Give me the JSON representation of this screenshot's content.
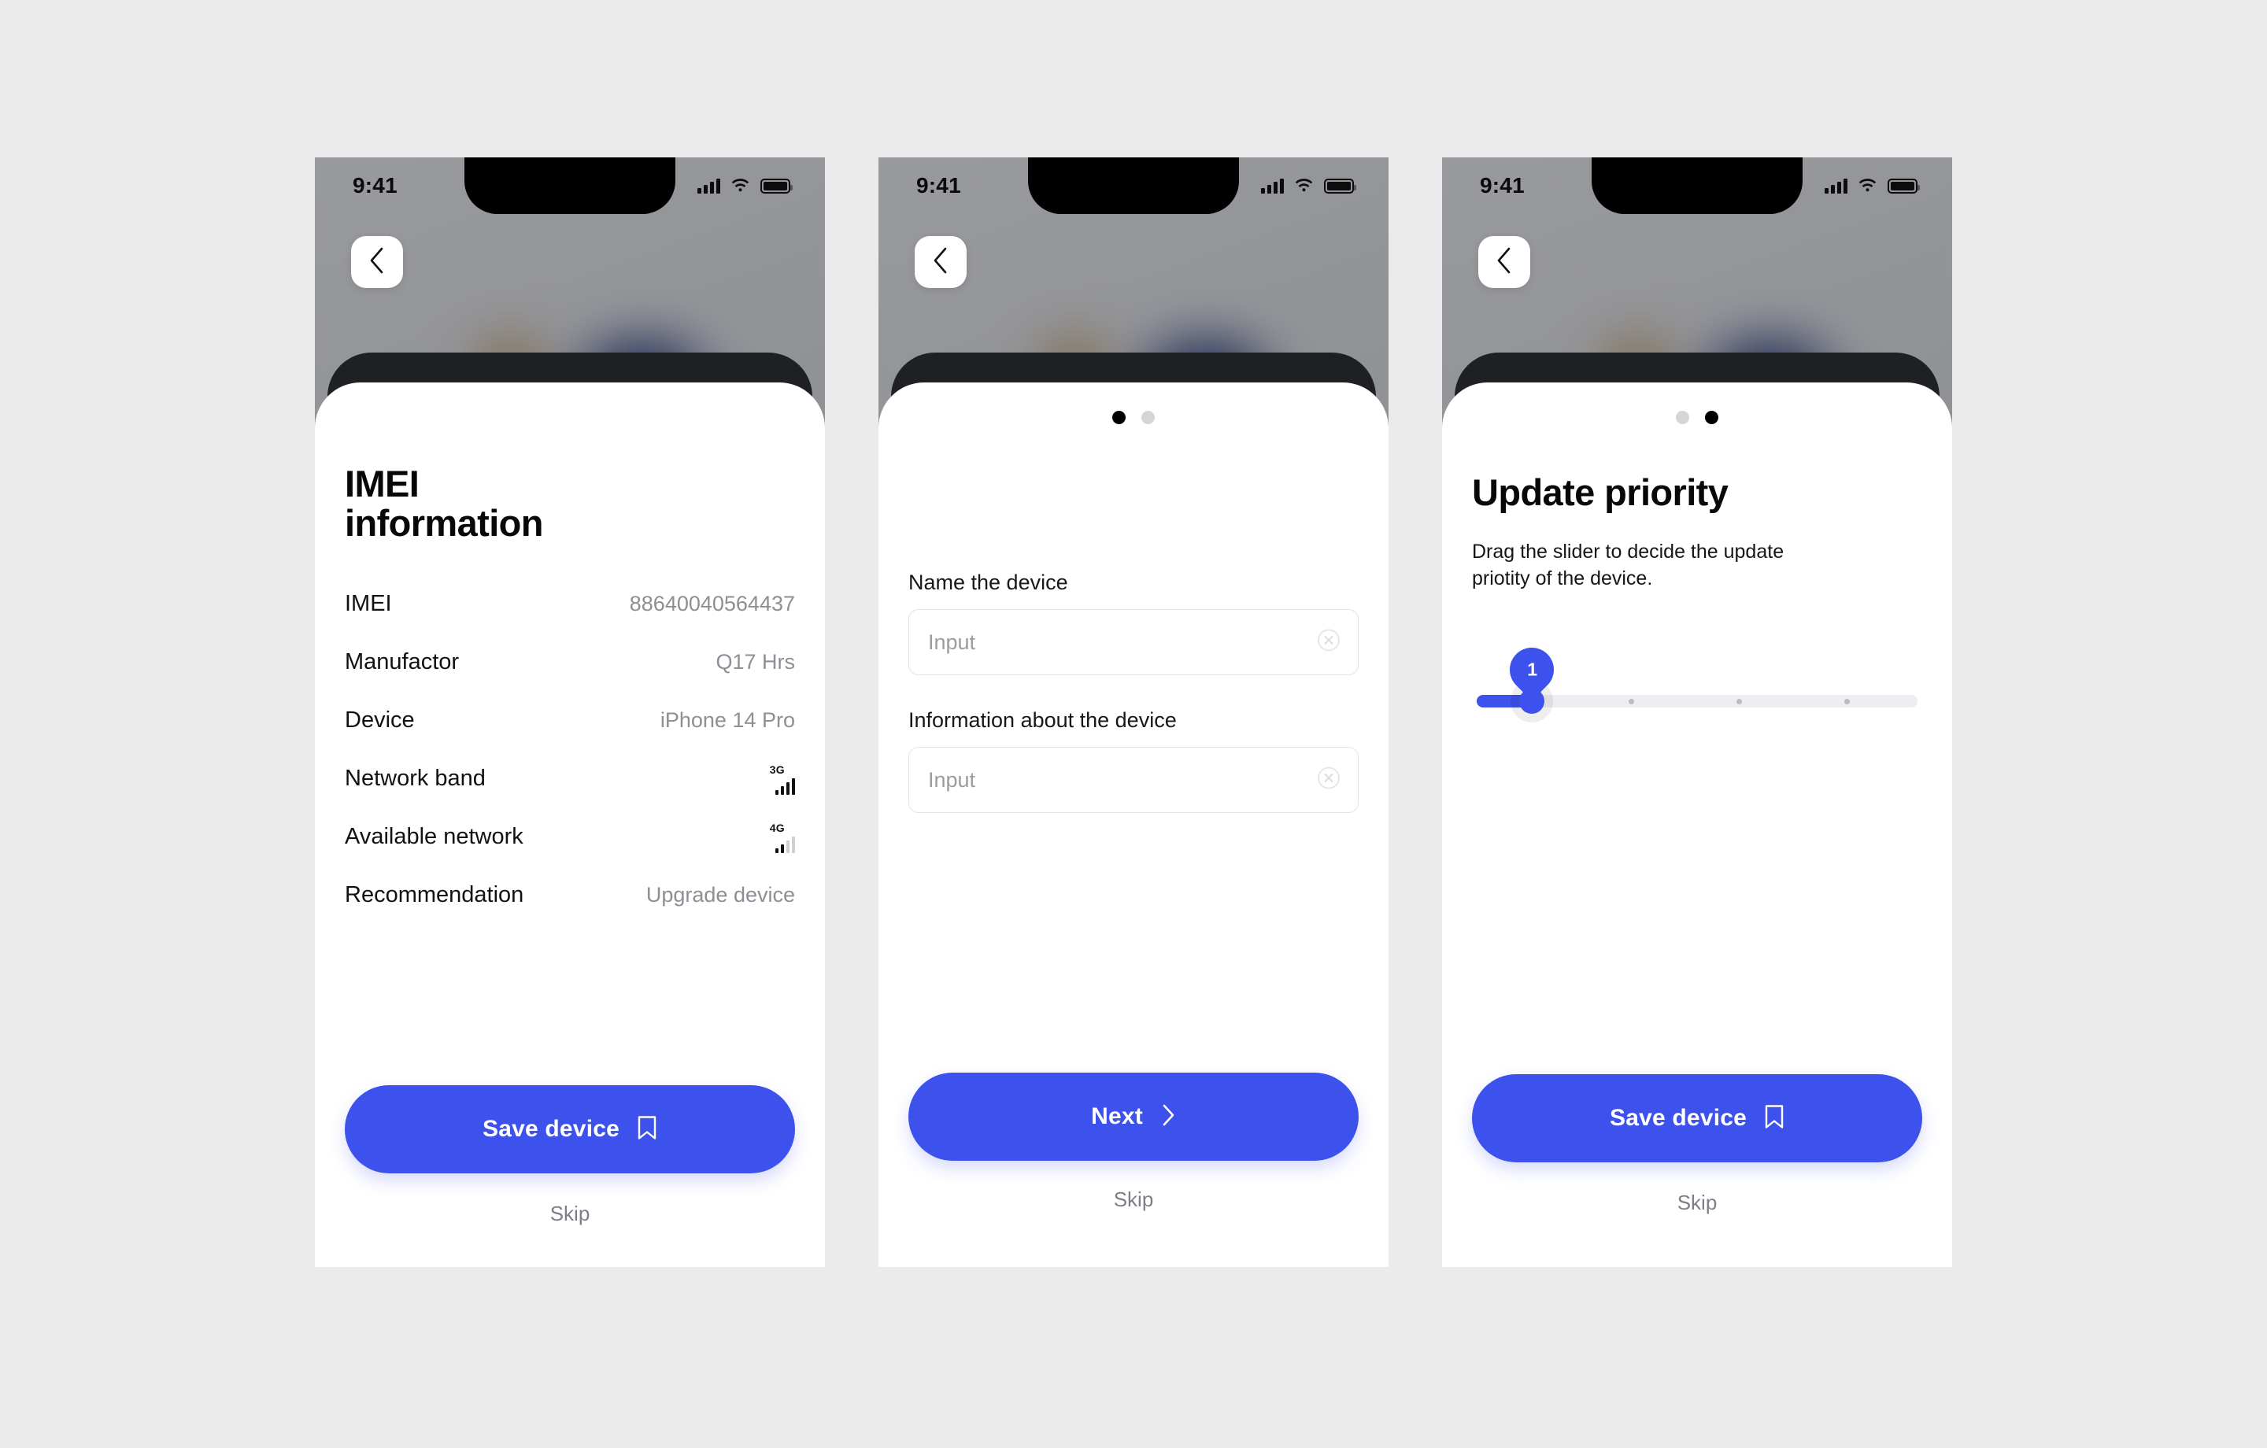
{
  "theme": {
    "accent": "#3D51EC",
    "page_background": "#EBEBEB",
    "sheet_background": "#FFFFFF",
    "muted_text": "#8D8F95"
  },
  "status_bar": {
    "time": "9:41",
    "icons": [
      "cellular-signal-icon",
      "wifi-icon",
      "battery-icon"
    ]
  },
  "screens": [
    {
      "id": "imei-information",
      "back_button": "chevron-left-icon",
      "title": "IMEI\ninformation",
      "title_line1": "IMEI",
      "title_line2": "information",
      "rows": [
        {
          "label": "IMEI",
          "value": "88640040564437",
          "type": "text"
        },
        {
          "label": "Manufactor",
          "value": "Q17 Hrs",
          "type": "text"
        },
        {
          "label": "Device",
          "value": "iPhone 14 Pro",
          "type": "text"
        },
        {
          "label": "Network band",
          "value": "3G",
          "type": "signal",
          "bars_filled": 4
        },
        {
          "label": "Available network",
          "value": "4G",
          "type": "signal",
          "bars_filled": 2
        },
        {
          "label": "Recommendation",
          "value": "Upgrade device",
          "type": "text"
        }
      ],
      "primary_action": {
        "label": "Save device",
        "icon": "bookmark-icon"
      },
      "secondary_action": {
        "label": "Skip"
      }
    },
    {
      "id": "name-the-device",
      "back_button": "chevron-left-icon",
      "pagination": {
        "count": 2,
        "active": 0
      },
      "fields": [
        {
          "label": "Name the device",
          "value": "Input",
          "placeholder": "Input",
          "clear_icon": "clear-circle-icon"
        },
        {
          "label": "Information about the device",
          "value": "Input",
          "placeholder": "Input",
          "clear_icon": "clear-circle-icon"
        }
      ],
      "primary_action": {
        "label": "Next",
        "icon": "chevron-right-icon"
      },
      "secondary_action": {
        "label": "Skip"
      }
    },
    {
      "id": "update-priority",
      "back_button": "chevron-left-icon",
      "pagination": {
        "count": 2,
        "active": 1
      },
      "title": "Update priority",
      "description": "Drag the slider to decide the update priotity of the device.",
      "slider": {
        "value": "1",
        "min": 1,
        "max": 4,
        "tick_count": 3,
        "bubble_label": "1"
      },
      "primary_action": {
        "label": "Save device",
        "icon": "bookmark-icon"
      },
      "secondary_action": {
        "label": "Skip"
      }
    }
  ]
}
